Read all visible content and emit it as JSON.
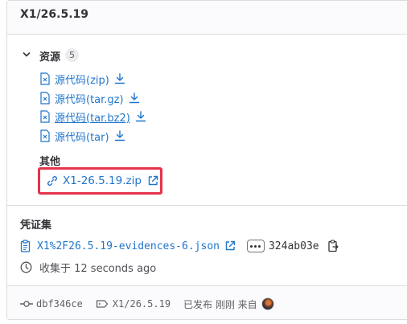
{
  "release": {
    "title": "X1/26.5.19"
  },
  "assets": {
    "label": "资源",
    "count": "5",
    "sources": [
      {
        "label": "源代码(zip)"
      },
      {
        "label": "源代码(tar.gz)"
      },
      {
        "label": "源代码(tar.bz2)"
      },
      {
        "label": "源代码(tar)"
      }
    ],
    "other_heading": "其他",
    "other_links": [
      {
        "label": "X1-26.5.19.zip"
      }
    ]
  },
  "evidence": {
    "heading": "凭证集",
    "file": "X1%2F26.5.19-evidences-6.json",
    "sha": "324ab03e",
    "collected": "收集于 12 seconds ago"
  },
  "footer": {
    "commit": "dbf346ce",
    "tag": "X1/26.5.19",
    "released_text": "已发布 刚刚 来自"
  },
  "colors": {
    "link": "#1f75cb",
    "highlight": "#e5334b",
    "text": "#333238"
  }
}
